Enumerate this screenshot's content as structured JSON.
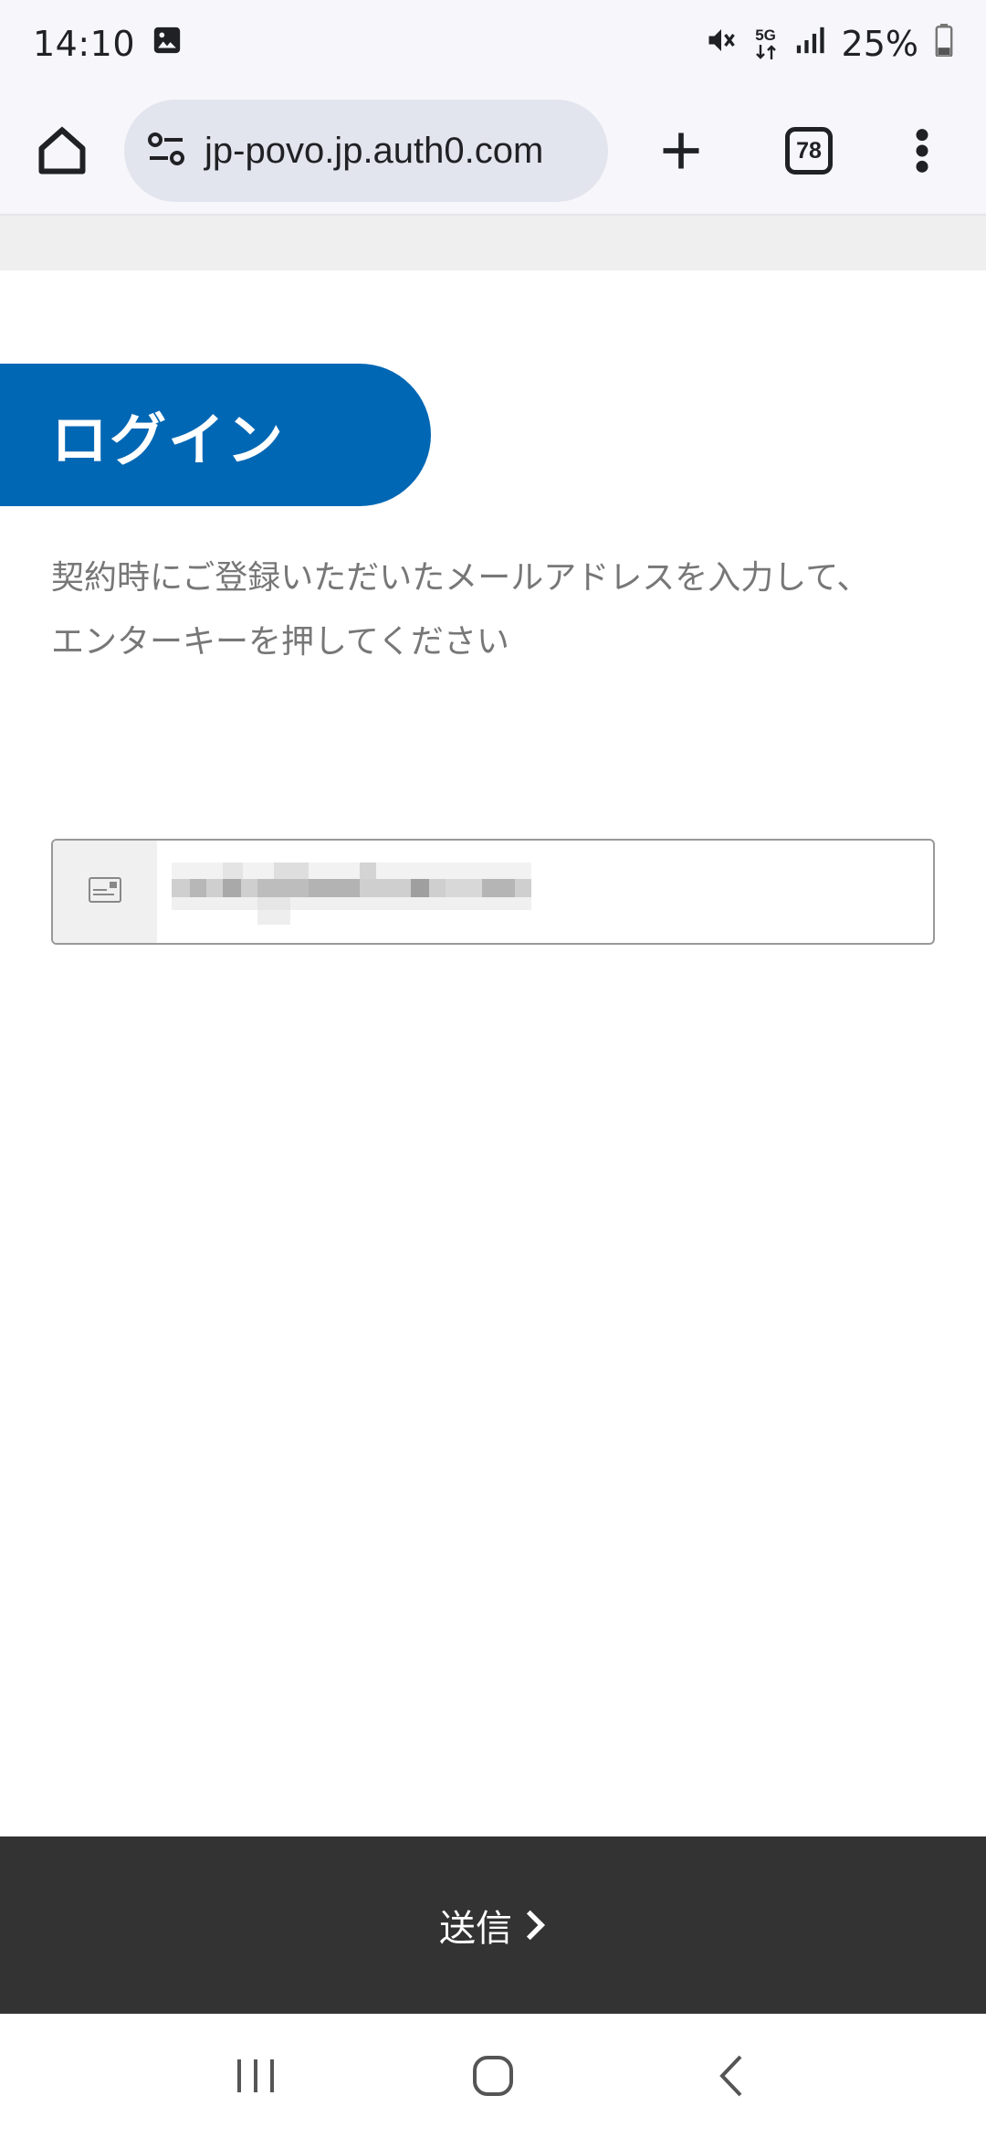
{
  "status_bar": {
    "time": "14:10",
    "battery": "25%",
    "network": "5G",
    "icons": [
      "image-icon",
      "mute-icon",
      "5g-data-icon",
      "signal-icon",
      "battery-icon"
    ]
  },
  "browser": {
    "url": "jp-povo.jp.auth0.com",
    "tab_count": "78",
    "icons": [
      "home-icon",
      "site-settings-icon",
      "plus-icon",
      "tabs-icon",
      "more-vert-icon"
    ]
  },
  "login": {
    "title": "ログイン",
    "instruction_line1": "契約時にご登録いただいたメールアドレスを入力して、",
    "instruction_line2": "エンターキーを押してください"
  },
  "email_field": {
    "icon": "email-card-icon",
    "value_obscured": true
  },
  "submit": {
    "label": "送信",
    "icon": "chevron-right-icon"
  },
  "nav_bar": {
    "icons": [
      "recents-icon",
      "home-circle-icon",
      "back-icon"
    ]
  },
  "colors": {
    "brand_blue": "#0067b4",
    "submit_bg": "#333333",
    "url_pill": "#e3e5ee",
    "text_gray": "#777777"
  }
}
